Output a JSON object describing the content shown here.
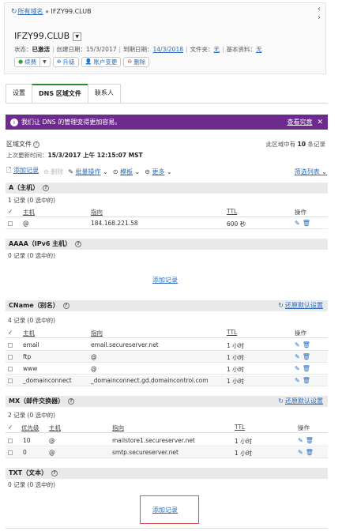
{
  "breadcrumb": {
    "link": "所有域名",
    "sep": "»",
    "current": "IFZY99.CLUB"
  },
  "domain": {
    "name": "IFZY99.CLUB",
    "status_label": "状态：",
    "status": "已激活",
    "created_label": "创建日期：",
    "created": "15/3/2017",
    "expires_label": "到期日期：",
    "expires": "14/3/2018",
    "folder_label": "文件夹：",
    "folder": "无",
    "profile_label": "基本资料：",
    "profile": "无"
  },
  "actions": {
    "renew": "续费",
    "upgrade": "升级",
    "account_change": "账户变更",
    "delete": "删除"
  },
  "tabs": [
    "设置",
    "DNS 区域文件",
    "联系人"
  ],
  "banner": {
    "text": "我们让 DNS 的管理变得更加容易。",
    "link": "查看究竟"
  },
  "zone": {
    "label": "区域文件",
    "count_prefix": "此区域中有",
    "count": "10",
    "count_suffix": "条记录",
    "updated_label": "上次更新时间：",
    "updated": "15/3/2017 上午 12:15:07 MST"
  },
  "toolbar": {
    "add": "添加记录",
    "delete": "删除",
    "bulk": "批量操作",
    "template": "模板",
    "more": "更多",
    "filter": "筛选列表"
  },
  "restore_label": "还原默认设置",
  "add_record": "添加记录",
  "sections": {
    "a": {
      "title": "A（主机）",
      "count": "1 记录 (0 选中的)",
      "headers": {
        "host": "主机",
        "points": "指向",
        "ttl": "TTL",
        "ops": "操作"
      },
      "rows": [
        {
          "host": "@",
          "points": "184.168.221.58",
          "ttl": "600 秒"
        }
      ]
    },
    "aaaa": {
      "title": "AAAA（IPv6 主机）",
      "count": "0 记录 (0 选中的)"
    },
    "cname": {
      "title": "CName（别名）",
      "count": "4 记录 (0 选中的)",
      "headers": {
        "host": "主机",
        "points": "指向",
        "ttl": "TTL",
        "ops": "操作"
      },
      "rows": [
        {
          "host": "email",
          "points": "email.secureserver.net",
          "ttl": "1 小时"
        },
        {
          "host": "ftp",
          "points": "@",
          "ttl": "1 小时"
        },
        {
          "host": "www",
          "points": "@",
          "ttl": "1 小时"
        },
        {
          "host": "_domainconnect",
          "points": "_domainconnect.gd.domaincontrol.com",
          "ttl": "1 小时"
        }
      ]
    },
    "mx": {
      "title": "MX（邮件交换器）",
      "count": "2 记录 (0 选中的)",
      "headers": {
        "priority": "优先级",
        "host": "主机",
        "points": "指向",
        "ttl": "TTL",
        "ops": "操作"
      },
      "rows": [
        {
          "priority": "10",
          "host": "@",
          "points": "mailstore1.secureserver.net",
          "ttl": "1 小时"
        },
        {
          "priority": "0",
          "host": "@",
          "points": "smtp.secureserver.net",
          "ttl": "1 小时"
        }
      ]
    },
    "txt": {
      "title": "TXT（文本）",
      "count": "0 记录 (0 选中的)"
    }
  },
  "icons": {
    "refresh": "refresh-icon",
    "edit": "edit-icon",
    "trash": "trash-icon",
    "info": "info-icon",
    "check": "check-icon"
  },
  "colors": {
    "link": "#2a6ebb",
    "banner": "#6e2a8f",
    "tab_active": "#2d8a3c",
    "highlight_box": "#d9534f"
  }
}
